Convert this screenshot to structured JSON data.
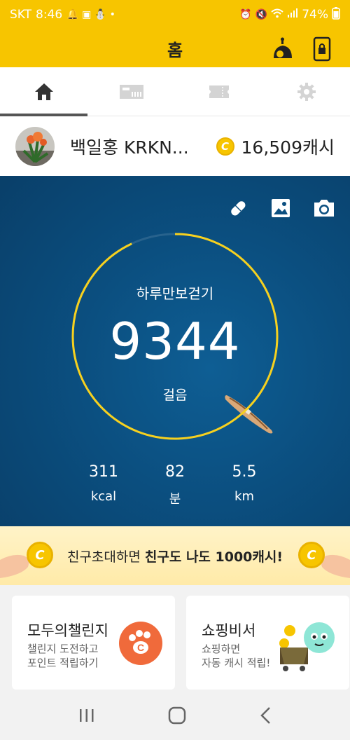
{
  "status_bar": {
    "carrier": "SKT",
    "time": "8:46",
    "battery": "74%"
  },
  "header": {
    "title": "홈",
    "icons": [
      "weather-icon",
      "phone-lock-icon"
    ]
  },
  "tabs": [
    {
      "name": "home",
      "icon": "home-icon",
      "active": true
    },
    {
      "name": "coupon",
      "icon": "coupon-icon",
      "active": false
    },
    {
      "name": "ticket",
      "icon": "ticket-icon",
      "active": false
    },
    {
      "name": "settings",
      "icon": "gear-icon",
      "active": false
    }
  ],
  "profile": {
    "name": "백일홍 KRKN...",
    "cash": "16,509캐시",
    "coin_symbol": "C"
  },
  "pedometer": {
    "label": "하루만보걷기",
    "steps": "9344",
    "steps_unit": "걸음",
    "progress": 0.93,
    "stats": [
      {
        "value": "311",
        "unit": "kcal"
      },
      {
        "value": "82",
        "unit": "분"
      },
      {
        "value": "5.5",
        "unit": "km"
      }
    ],
    "accent_color": "#f7d11e"
  },
  "banner": {
    "text_prefix": "친구초대하면 ",
    "text_bold": "친구도 나도 1000캐시!"
  },
  "cards": [
    {
      "title": "모두의챌린지",
      "line1": "챌린지 도전하고",
      "line2": "포인트 적립하기"
    },
    {
      "title": "쇼핑비서",
      "line1": "쇼핑하면",
      "line2": "자동 캐시 적립!"
    }
  ],
  "colors": {
    "brand_yellow": "#f7c500",
    "hero_blue": "#0b4f80"
  }
}
